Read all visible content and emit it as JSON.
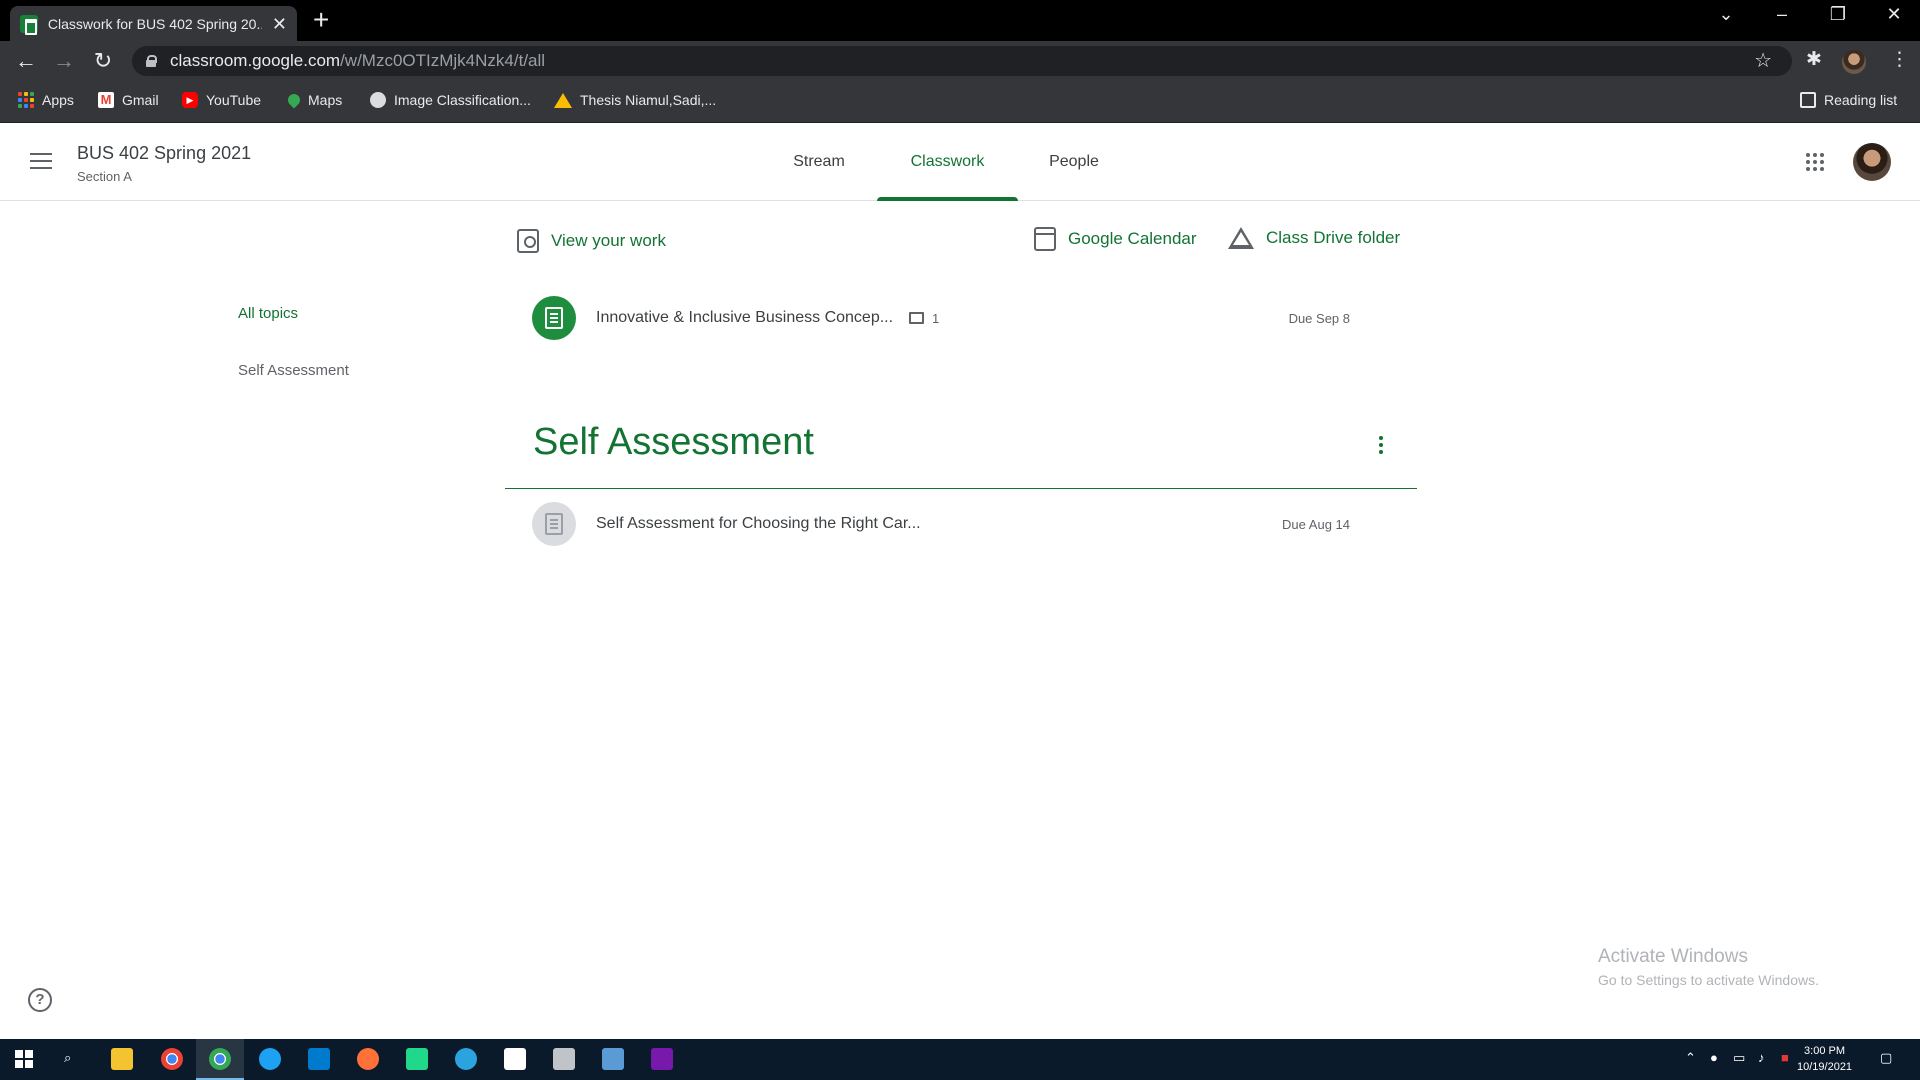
{
  "browser": {
    "tab_title": "Classwork for BUS 402 Spring 20...",
    "url_host": "classroom.google.com",
    "url_path": "/w/Mzc0OTIzMjk4Nzk4/t/all",
    "bookmarks": [
      {
        "label": "Apps",
        "icon": "apps-grid-icon"
      },
      {
        "label": "Gmail",
        "icon": "gmail-icon"
      },
      {
        "label": "YouTube",
        "icon": "youtube-icon"
      },
      {
        "label": "Maps",
        "icon": "maps-icon"
      },
      {
        "label": "Image Classification...",
        "icon": "globe-icon"
      },
      {
        "label": "Thesis Niamul,Sadi,...",
        "icon": "drive-icon"
      }
    ],
    "reading_list": "Reading list"
  },
  "header": {
    "class_name": "BUS 402 Spring 2021",
    "section": "Section A",
    "tabs": [
      {
        "label": "Stream",
        "active": false
      },
      {
        "label": "Classwork",
        "active": true
      },
      {
        "label": "People",
        "active": false
      }
    ]
  },
  "actions": {
    "view_work": "View your work",
    "calendar": "Google Calendar",
    "drive": "Class Drive folder"
  },
  "topics": {
    "all": "All topics",
    "items": [
      "Self Assessment"
    ]
  },
  "assignments": [
    {
      "title": "Innovative & Inclusive Business Concep...",
      "comments": "1",
      "due": "Due Sep 8",
      "status": "assigned"
    },
    {
      "title": "Self Assessment for Choosing the Right Car...",
      "due": "Due Aug 14",
      "status": "inactive"
    }
  ],
  "section": {
    "title": "Self Assessment"
  },
  "watermark": {
    "line1": "Activate Windows",
    "line2": "Go to Settings to activate Windows."
  },
  "taskbar": {
    "time": "3:00 PM",
    "date": "10/19/2021"
  },
  "colors": {
    "accent": "#137333",
    "assignment_green": "#1e8e3e"
  }
}
